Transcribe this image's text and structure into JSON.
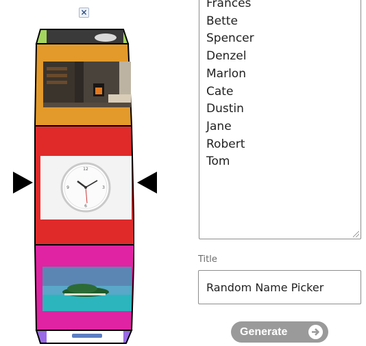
{
  "close": {
    "label": "×"
  },
  "wheel": {
    "slots": [
      {
        "color": "#a4d65e",
        "picture": "partial-image"
      },
      {
        "color": "#e39a2a",
        "picture": "wood-stove-living-room"
      },
      {
        "color": "#e02a2a",
        "picture": "wall-clock"
      },
      {
        "color": "#e023a2",
        "picture": "tropical-island"
      },
      {
        "color": "#9a6ae6",
        "picture": "partial-image"
      }
    ]
  },
  "names": [
    "Frances",
    "Bette",
    "Spencer",
    "Denzel",
    "Marlon",
    "Cate",
    "Dustin",
    "Jane",
    "Robert",
    "Tom"
  ],
  "title_field": {
    "label": "Title",
    "value": "Random Name Picker"
  },
  "generate": {
    "label": "Generate"
  }
}
